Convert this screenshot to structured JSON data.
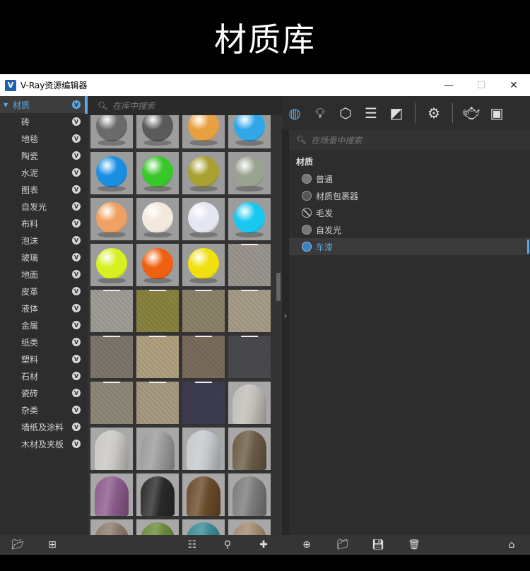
{
  "banner": {
    "title": "材质库"
  },
  "window": {
    "title": "V-Ray资源编辑器",
    "logo": "V",
    "controls": {
      "minimize": "—",
      "maximize": "☐",
      "close": "✕"
    }
  },
  "library": {
    "categories": [
      {
        "label": "材质",
        "root": true
      },
      {
        "label": "砖"
      },
      {
        "label": "地毯"
      },
      {
        "label": "陶瓷"
      },
      {
        "label": "水泥"
      },
      {
        "label": "图表"
      },
      {
        "label": "自发光"
      },
      {
        "label": "布料"
      },
      {
        "label": "泡沫"
      },
      {
        "label": "玻璃"
      },
      {
        "label": "地面"
      },
      {
        "label": "皮革"
      },
      {
        "label": "液体"
      },
      {
        "label": "金属"
      },
      {
        "label": "纸类"
      },
      {
        "label": "塑料"
      },
      {
        "label": "石材"
      },
      {
        "label": "瓷砖"
      },
      {
        "label": "杂类"
      },
      {
        "label": "墙纸及涂料"
      },
      {
        "label": "木材及夹板"
      }
    ],
    "search_placeholder": "在库中搜索",
    "tiles": [
      {
        "kind": "sphere",
        "color": "#6a6a6a"
      },
      {
        "kind": "sphere",
        "color": "#5a5a5a"
      },
      {
        "kind": "sphere",
        "color": "#e8a040"
      },
      {
        "kind": "sphere",
        "color": "#30a8e8"
      },
      {
        "kind": "sphere",
        "color": "#1a8ee0"
      },
      {
        "kind": "sphere",
        "color": "#38c82a"
      },
      {
        "kind": "sphere",
        "color": "#a8a030"
      },
      {
        "kind": "sphere",
        "color": "#9aa290"
      },
      {
        "kind": "sphere",
        "color": "#f0a060"
      },
      {
        "kind": "sphere",
        "color": "#f2e8dc"
      },
      {
        "kind": "sphere",
        "color": "#e4e6f2"
      },
      {
        "kind": "sphere",
        "color": "#18c8f0"
      },
      {
        "kind": "sphere",
        "color": "#d8f020"
      },
      {
        "kind": "sphere",
        "color": "#f06010"
      },
      {
        "kind": "sphere",
        "color": "#f0e010"
      },
      {
        "kind": "flat",
        "color": "#9a968e"
      },
      {
        "kind": "flat",
        "color": "#a09d97"
      },
      {
        "kind": "flat",
        "color": "#8a8240"
      },
      {
        "kind": "flat",
        "color": "#8c826a"
      },
      {
        "kind": "flat",
        "color": "#a69c88"
      },
      {
        "kind": "flat",
        "color": "#7c766c"
      },
      {
        "kind": "flat",
        "color": "#b0a080"
      },
      {
        "kind": "flat",
        "color": "#7a6c5c"
      },
      {
        "kind": "flat",
        "color": "#4a4a4e"
      },
      {
        "kind": "flat",
        "color": "#8e8878"
      },
      {
        "kind": "flat",
        "color": "#a89a80"
      },
      {
        "kind": "flat",
        "color": "#3e3c52"
      },
      {
        "kind": "cloth",
        "color": "#c0bcb6"
      },
      {
        "kind": "cloth",
        "color": "#c8c6c2"
      },
      {
        "kind": "cloth",
        "color": "#9a9a9a"
      },
      {
        "kind": "cloth",
        "color": "#c4c8cc"
      },
      {
        "kind": "cloth",
        "color": "#6a5a44"
      },
      {
        "kind": "cloth",
        "color": "#8a5a8a"
      },
      {
        "kind": "cloth",
        "color": "#2a2a2a"
      },
      {
        "kind": "cloth",
        "color": "#6a4a2a"
      },
      {
        "kind": "cloth",
        "color": "#7a7a7a"
      },
      {
        "kind": "cloth",
        "color": "#8a7a6a"
      },
      {
        "kind": "cloth",
        "color": "#6a8a3a"
      },
      {
        "kind": "cloth",
        "color": "#3a8a96"
      },
      {
        "kind": "cloth",
        "color": "#a08a70"
      }
    ]
  },
  "scene": {
    "search_placeholder": "在场景中搜索",
    "header": "材质",
    "items": [
      {
        "label": "普通",
        "icon": "sphere-icon"
      },
      {
        "label": "材质包裹器",
        "icon": "wrapper-icon"
      },
      {
        "label": "毛发",
        "icon": "no-icon"
      },
      {
        "label": "自发光",
        "icon": "sphere-icon"
      },
      {
        "label": "车漆",
        "icon": "carpaint-icon",
        "selected": true
      }
    ]
  },
  "icons": {
    "toolbar": [
      "materials-icon",
      "lights-icon",
      "geometry-icon",
      "layers-icon",
      "textures-icon",
      "settings-icon",
      "teapot-icon",
      "render-window-icon"
    ],
    "bottom": [
      "open-folder-icon",
      "layout-icon",
      "list-view-icon",
      "preview-icon",
      "add-icon",
      "new-material-icon",
      "folder-icon",
      "save-icon",
      "delete-icon",
      "clean-icon"
    ]
  },
  "accent": "#5aa9e6"
}
